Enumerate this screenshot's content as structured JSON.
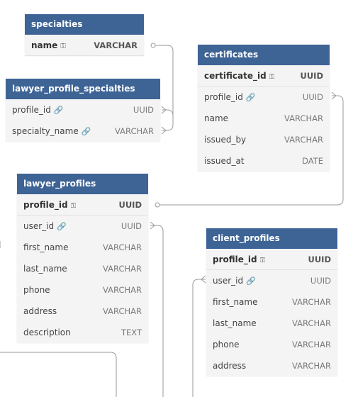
{
  "tables": {
    "specialties": {
      "title": "specialties",
      "rows": [
        {
          "name": "name",
          "type": "VARCHAR",
          "key": "pk"
        }
      ]
    },
    "lawyer_profile_specialties": {
      "title": "lawyer_profile_specialties",
      "rows": [
        {
          "name": "profile_id",
          "type": "UUID",
          "key": "fk"
        },
        {
          "name": "specialty_name",
          "type": "VARCHAR",
          "key": "fk"
        }
      ]
    },
    "certificates": {
      "title": "certificates",
      "rows": [
        {
          "name": "certificate_id",
          "type": "UUID",
          "key": "pk"
        },
        {
          "name": "profile_id",
          "type": "UUID",
          "key": "fk"
        },
        {
          "name": "name",
          "type": "VARCHAR"
        },
        {
          "name": "issued_by",
          "type": "VARCHAR"
        },
        {
          "name": "issued_at",
          "type": "DATE"
        }
      ]
    },
    "lawyer_profiles": {
      "title": "lawyer_profiles",
      "rows": [
        {
          "name": "profile_id",
          "type": "UUID",
          "key": "pk"
        },
        {
          "name": "user_id",
          "type": "UUID",
          "key": "fk"
        },
        {
          "name": "first_name",
          "type": "VARCHAR"
        },
        {
          "name": "last_name",
          "type": "VARCHAR"
        },
        {
          "name": "phone",
          "type": "VARCHAR"
        },
        {
          "name": "address",
          "type": "VARCHAR"
        },
        {
          "name": "description",
          "type": "TEXT"
        }
      ]
    },
    "client_profiles": {
      "title": "client_profiles",
      "rows": [
        {
          "name": "profile_id",
          "type": "UUID",
          "key": "pk"
        },
        {
          "name": "user_id",
          "type": "UUID",
          "key": "fk"
        },
        {
          "name": "first_name",
          "type": "VARCHAR"
        },
        {
          "name": "last_name",
          "type": "VARCHAR"
        },
        {
          "name": "phone",
          "type": "VARCHAR"
        },
        {
          "name": "address",
          "type": "VARCHAR"
        }
      ]
    }
  },
  "icons": {
    "pk": "key-icon",
    "fk": "link-icon"
  },
  "colors": {
    "header": "#3e6496",
    "body": "#f4f4f4",
    "connector": "#9a9a9a"
  }
}
